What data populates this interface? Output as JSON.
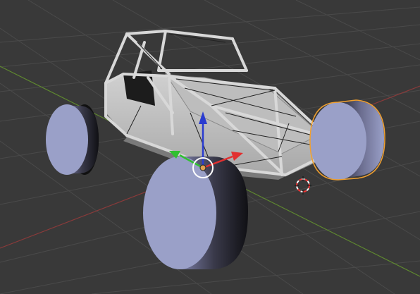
{
  "viewport": {
    "mode": "3d-viewport-perspective",
    "background_color": "#393939",
    "grid_color": "#4a4a4a",
    "axis_x_color": "#8a3a3a",
    "axis_y_color": "#5f8a2f",
    "selection_outline_color": "#f0a030"
  },
  "scene": {
    "model": "buggy-roll-cage-with-four-wheels",
    "frame_color": "#c8c8c8",
    "wheel_tread_color": "#9aa0c8",
    "wheel_side_color": "#2a2a2a",
    "selected_object": "rear-right-wheel"
  },
  "gizmo": {
    "type": "translate-manipulator",
    "x_arrow_color": "#e23030",
    "y_arrow_color": "#30c030",
    "z_arrow_color": "#2a3cd0",
    "pivot_color": "#e0a050"
  },
  "cursor_3d": {
    "icon": "3d-cursor-icon"
  }
}
